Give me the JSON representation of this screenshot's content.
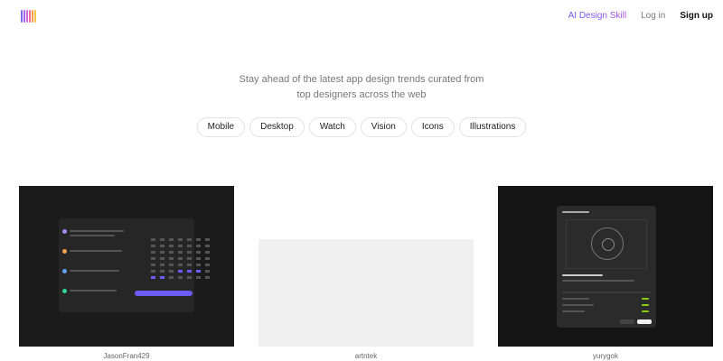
{
  "brand": {
    "logo_colors": [
      "#7c6cf2",
      "#a864e8",
      "#d06bd8",
      "#f06aa0",
      "#f4a04c",
      "#f5c84a"
    ]
  },
  "nav": {
    "ai_design_skill": "AI Design Skill",
    "login": "Log in",
    "signup": "Sign up"
  },
  "hero": {
    "line1": "Stay ahead of the latest app design trends curated from",
    "line2": "top designers across the web"
  },
  "categories": [
    "Mobile",
    "Desktop",
    "Watch",
    "Vision",
    "Icons",
    "Illustrations"
  ],
  "cards": [
    {
      "author": "JasonFran429"
    },
    {
      "author": "artntek"
    },
    {
      "author": "yurygok"
    }
  ]
}
